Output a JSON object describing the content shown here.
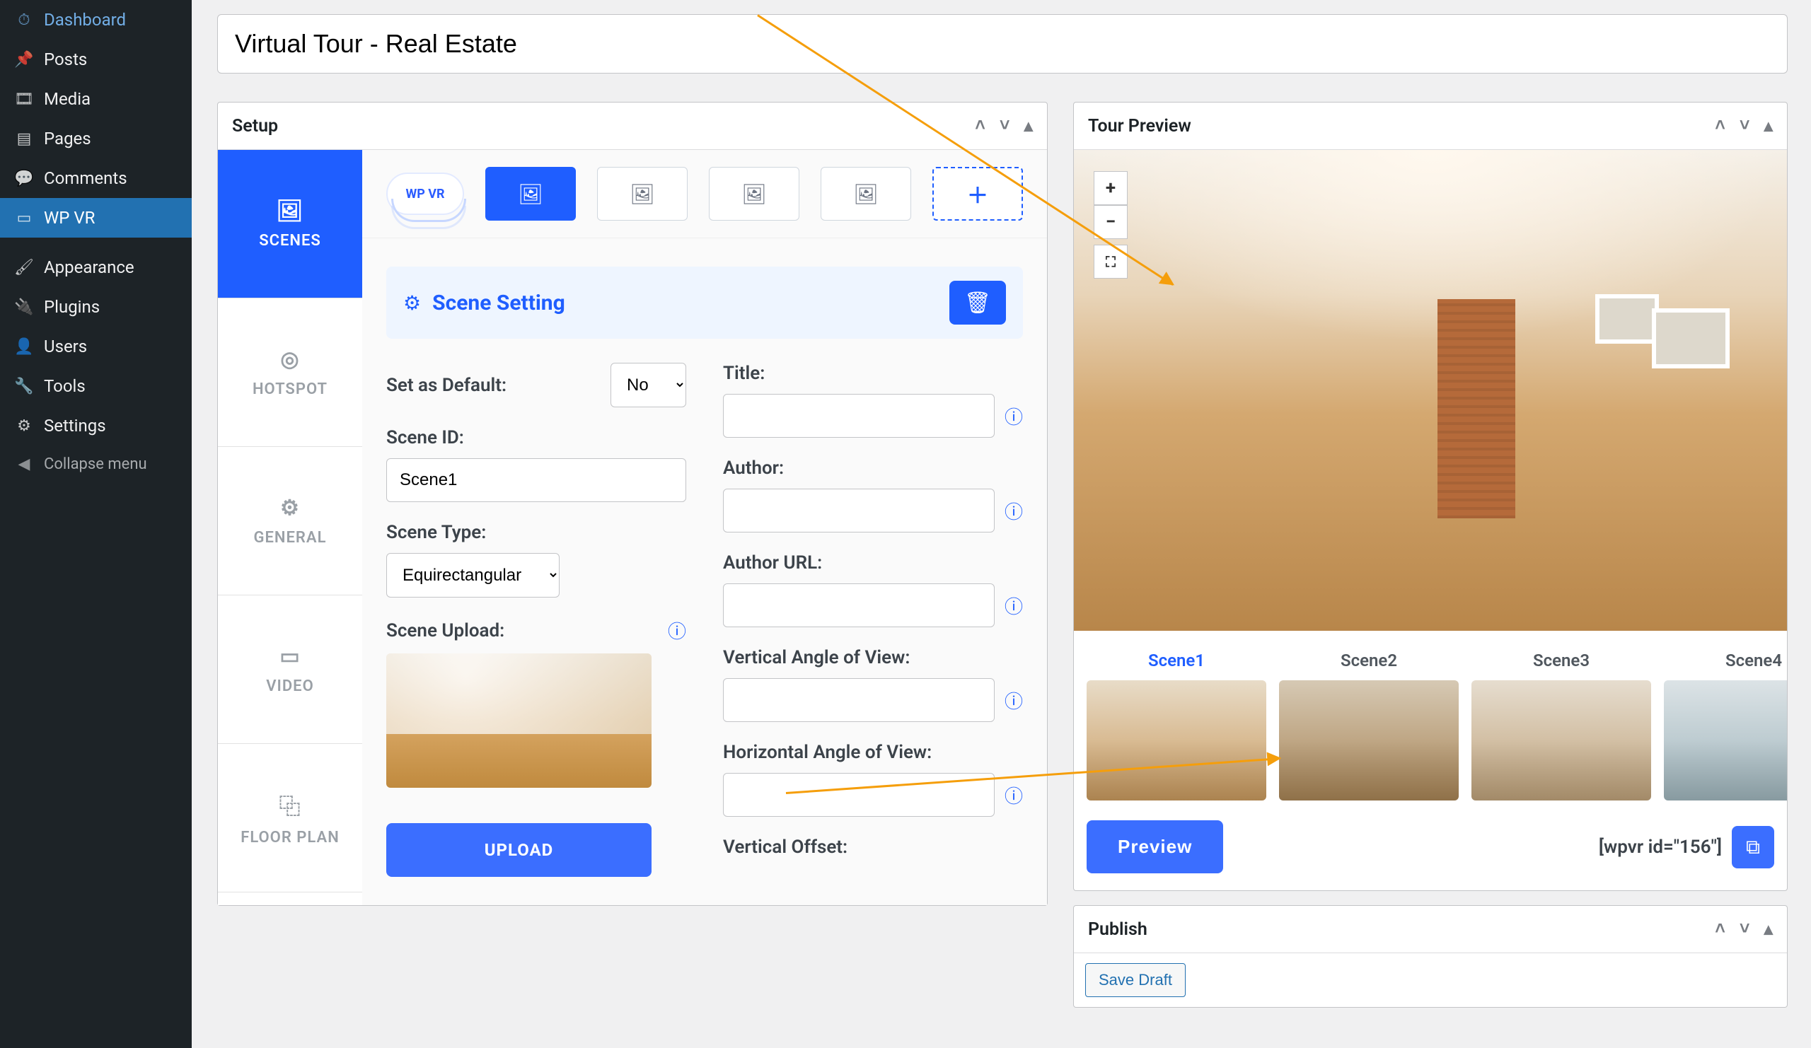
{
  "sidebar": {
    "items": [
      {
        "icon": "🏠",
        "label": "Dashboard"
      },
      {
        "icon": "📌",
        "label": "Posts"
      },
      {
        "icon": "🖼",
        "label": "Media"
      },
      {
        "icon": "📄",
        "label": "Pages"
      },
      {
        "icon": "💬",
        "label": "Comments"
      },
      {
        "icon": "🕶",
        "label": "WP VR"
      },
      {
        "icon": "🎨",
        "label": "Appearance"
      },
      {
        "icon": "🔌",
        "label": "Plugins"
      },
      {
        "icon": "👤",
        "label": "Users"
      },
      {
        "icon": "🔧",
        "label": "Tools"
      },
      {
        "icon": "⚙",
        "label": "Settings"
      }
    ],
    "collapse": "Collapse menu"
  },
  "page_title": "Virtual Tour - Real Estate",
  "setup": {
    "title": "Setup",
    "logo": "WP VR",
    "tabs": [
      {
        "label": "SCENES"
      },
      {
        "label": "HOTSPOT"
      },
      {
        "label": "GENERAL"
      },
      {
        "label": "VIDEO"
      },
      {
        "label": "FLOOR PLAN"
      }
    ],
    "section_title": "Scene Setting",
    "fields": {
      "set_default": "Set as Default:",
      "set_default_value": "No",
      "scene_id": "Scene ID:",
      "scene_id_value": "Scene1",
      "scene_type": "Scene Type:",
      "scene_type_value": "Equirectangular",
      "scene_upload": "Scene Upload:",
      "upload_btn": "UPLOAD",
      "title": "Title:",
      "author": "Author:",
      "author_url": "Author URL:",
      "vaov": "Vertical Angle of View:",
      "haov": "Horizontal Angle of View:",
      "voffset": "Vertical Offset:"
    }
  },
  "preview": {
    "title": "Tour Preview",
    "scenes": [
      "Scene1",
      "Scene2",
      "Scene3",
      "Scene4"
    ],
    "preview_btn": "Preview",
    "shortcode": "[wpvr id=\"156\"]"
  },
  "publish": {
    "title": "Publish",
    "save_draft": "Save Draft"
  }
}
